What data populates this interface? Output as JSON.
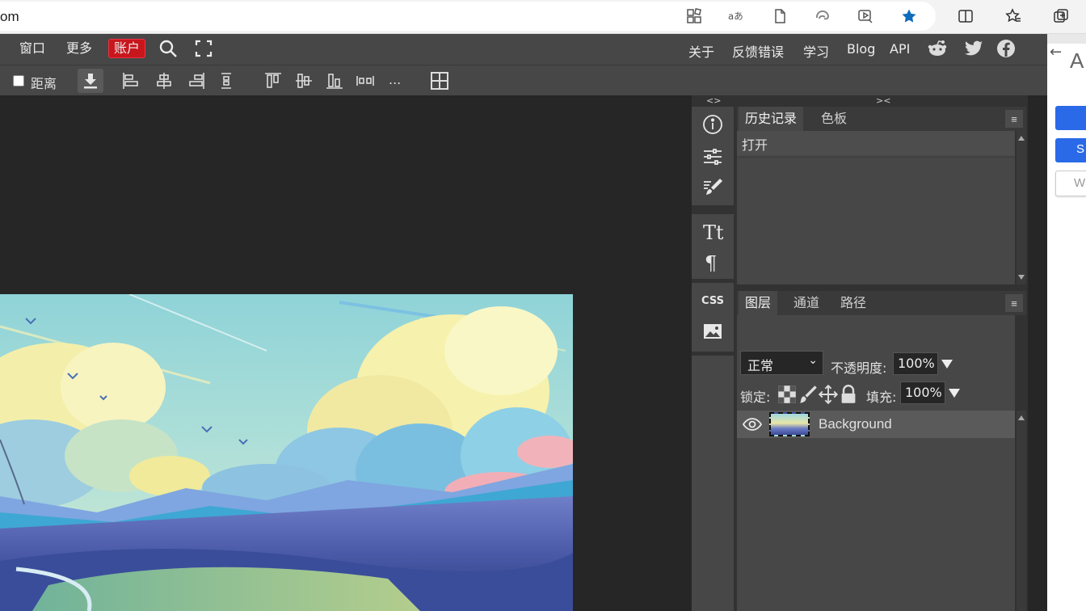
{
  "browser": {
    "url": "om",
    "toolbar_icons": [
      "apps-icon",
      "read-aloud-icon",
      "page-icon",
      "edge-icon",
      "video-icon",
      "favorite-star-icon",
      "split-screen-icon",
      "favorites-icon",
      "collections-icon"
    ]
  },
  "menubar": {
    "items": [
      "窗口",
      "更多",
      "账户"
    ],
    "right_links": [
      "关于",
      "反馈错误",
      "学习",
      "Blog",
      "API"
    ],
    "social": [
      "reddit-icon",
      "twitter-icon",
      "facebook-icon"
    ]
  },
  "options": {
    "distance_label": "距离",
    "more": "...",
    "distance_checked": false
  },
  "strip": {
    "collapse_left": "<>",
    "collapse_right": "><",
    "css_label": "CSS"
  },
  "history_panel": {
    "tabs": [
      "历史记录",
      "色板"
    ],
    "entries": [
      "打开"
    ]
  },
  "layers_panel": {
    "tabs": [
      "图层",
      "通道",
      "路径"
    ],
    "blend_mode": "正常",
    "opacity_label": "不透明度:",
    "opacity_value": "100%",
    "lock_label": "锁定:",
    "fill_label": "填充:",
    "fill_value": "100%",
    "layers": [
      {
        "name": "Background",
        "visible": true
      }
    ]
  },
  "right_page": {
    "letter": "A",
    "partial_button_text": "S",
    "partial_field_text": "W"
  },
  "colors": {
    "accent_account": "#c8161d",
    "edge_blue": "#0f6cbd",
    "app_panel": "#474747",
    "app_bg": "#262626"
  }
}
